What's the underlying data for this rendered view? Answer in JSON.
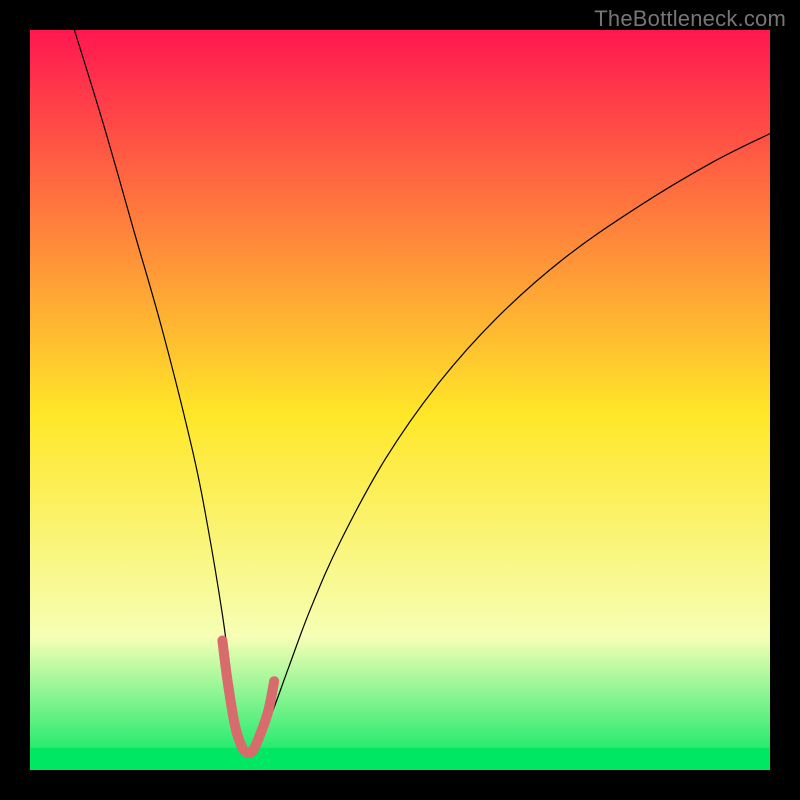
{
  "watermark": "TheBottleneck.com",
  "chart_data": {
    "type": "line",
    "title": "",
    "xlabel": "",
    "ylabel": "",
    "xlim": [
      0,
      100
    ],
    "ylim": [
      0,
      100
    ],
    "grid": false,
    "legend": false,
    "background_gradient": {
      "top_color": "#ff1750",
      "mid_color": "#ffe728",
      "mid2_color": "#f6ffb5",
      "bottom_color": "#00e763"
    },
    "green_band_y": [
      0,
      3
    ],
    "series": [
      {
        "name": "bottleneck-curve",
        "stroke": "#000000",
        "stroke_width": 1.2,
        "x": [
          6,
          10,
          14,
          18,
          22,
          24,
          26,
          27.2,
          28,
          28.7,
          29.5,
          30.8,
          33,
          35,
          38,
          42,
          48,
          55,
          63,
          72,
          82,
          92,
          100
        ],
        "values": [
          100,
          87,
          73,
          59,
          43,
          33,
          21,
          12,
          6.5,
          3.2,
          2.4,
          3.0,
          8.5,
          14,
          22,
          31,
          42,
          52,
          61,
          69,
          76,
          82,
          86
        ]
      },
      {
        "name": "trough-highlight",
        "stroke": "#d86b6b",
        "stroke_width": 10,
        "linecap": "round",
        "x": [
          26.0,
          26.7,
          27.7,
          28.6,
          29.3,
          30.1,
          31.1,
          32.2,
          33.0
        ],
        "values": [
          17.5,
          12.0,
          6.0,
          3.2,
          2.4,
          2.6,
          4.8,
          8.0,
          12.0
        ]
      }
    ]
  }
}
